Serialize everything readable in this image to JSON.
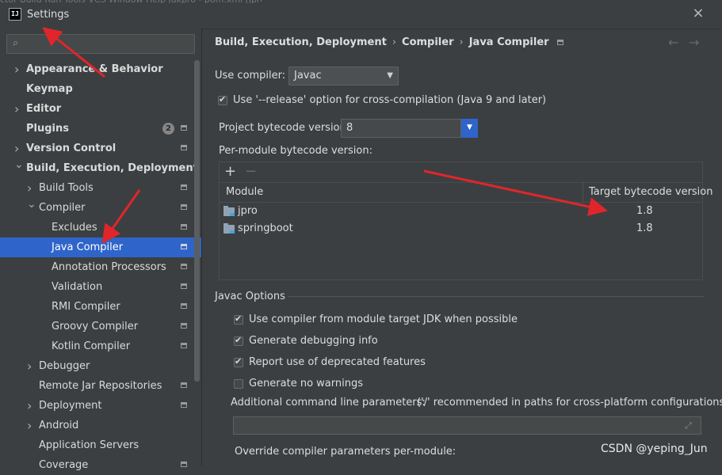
{
  "window": {
    "title": "Settings",
    "menubar_partial": "ctor   Build   Run   Tools   VCS   Window   Help      jdkpro - pom.xml [jpro]",
    "app_icon": "IJ"
  },
  "sidebar": {
    "search_placeholder": "",
    "items": [
      {
        "label": "Appearance & Behavior"
      },
      {
        "label": "Keymap"
      },
      {
        "label": "Editor"
      },
      {
        "label": "Plugins",
        "badge": "2"
      },
      {
        "label": "Version Control"
      },
      {
        "label": "Build, Execution, Deployment"
      },
      {
        "label": "Build Tools"
      },
      {
        "label": "Compiler"
      },
      {
        "label": "Excludes"
      },
      {
        "label": "Java Compiler"
      },
      {
        "label": "Annotation Processors"
      },
      {
        "label": "Validation"
      },
      {
        "label": "RMI Compiler"
      },
      {
        "label": "Groovy Compiler"
      },
      {
        "label": "Kotlin Compiler"
      },
      {
        "label": "Debugger"
      },
      {
        "label": "Remote Jar Repositories"
      },
      {
        "label": "Deployment"
      },
      {
        "label": "Android"
      },
      {
        "label": "Application Servers"
      },
      {
        "label": "Coverage"
      }
    ]
  },
  "breadcrumb": [
    "Build, Execution, Deployment",
    "Compiler",
    "Java Compiler"
  ],
  "use_compiler": {
    "label": "Use compiler:",
    "value": "Javac"
  },
  "release_option": {
    "label": "Use '--release' option for cross-compilation (Java 9 and later)",
    "checked": true
  },
  "project_bytecode": {
    "label": "Project bytecode version:",
    "value": "8"
  },
  "per_module": {
    "label": "Per-module bytecode version:",
    "add": "+",
    "remove": "−",
    "columns": [
      "Module",
      "Target bytecode version"
    ],
    "rows": [
      {
        "module": "jpro",
        "version": "1.8"
      },
      {
        "module": "springboot",
        "version": "1.8"
      }
    ]
  },
  "javac_options": {
    "title": "Javac Options",
    "checkboxes": [
      {
        "label": "Use compiler from module target JDK when possible",
        "checked": true
      },
      {
        "label": "Generate debugging info",
        "checked": true
      },
      {
        "label": "Report use of deprecated features",
        "checked": true
      },
      {
        "label": "Generate no warnings",
        "checked": false
      }
    ],
    "additional_label": "Additional command line parameters:",
    "additional_hint": "('/' recommended in paths for cross-platform configurations)",
    "additional_value": "",
    "override_label": "Override compiler parameters per-module:"
  },
  "watermark": "CSDN @yeping_Jun",
  "colors": {
    "accent": "#2f65ca",
    "annotation_arrow": "#e0262b"
  }
}
